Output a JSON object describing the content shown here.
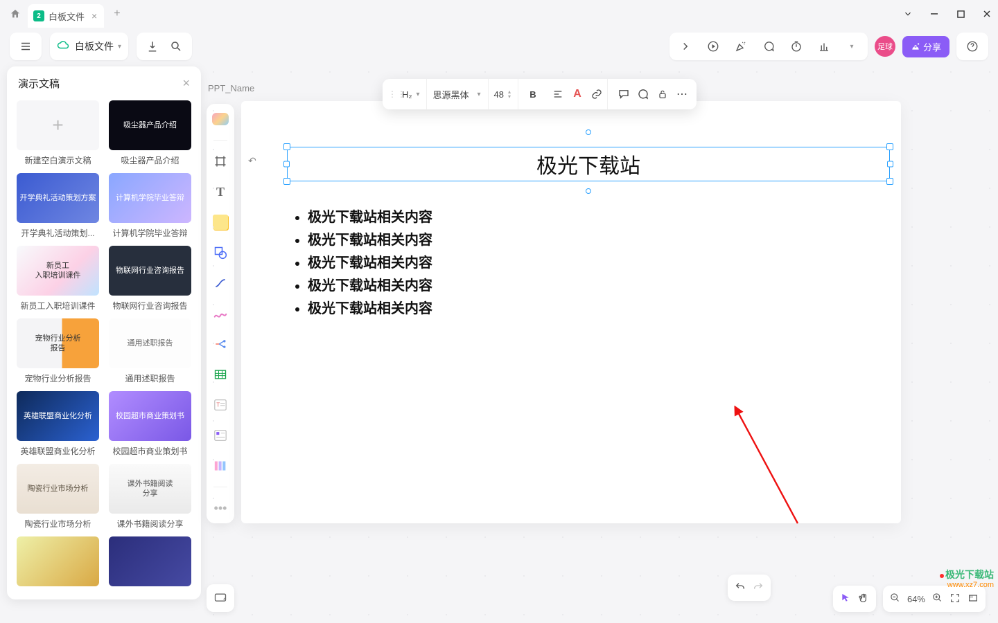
{
  "tabs": {
    "title": "白板文件"
  },
  "filedrop": {
    "name": "白板文件"
  },
  "toolbar_right": {
    "share": "分享",
    "avatar": "足球"
  },
  "panel": {
    "title": "演示文稿",
    "items": [
      {
        "label": "新建空白演示文稿",
        "bg": "add",
        "txt": "+"
      },
      {
        "label": "吸尘器产品介绍",
        "bg": "#0a0a14",
        "txt": "吸尘器产品介绍"
      },
      {
        "label": "开学典礼活动策划...",
        "bg": "linear-gradient(135deg,#3b5bd1,#6f86e2)",
        "txt": "开学典礼活动策划方案"
      },
      {
        "label": "计算机学院毕业答辩",
        "bg": "linear-gradient(135deg,#8aa7ff,#cdb6ff)",
        "txt": "计算机学院毕业答辩"
      },
      {
        "label": "新员工入职培训课件",
        "bg": "linear-gradient(135deg,#f8fafc,#fcd1e6 60%,#bfe3ff)",
        "txt": "新员工\\n入职培训课件",
        "fg": "#333"
      },
      {
        "label": "物联网行业咨询报告",
        "bg": "#272f3d",
        "txt": "物联网行业咨询报告"
      },
      {
        "label": "宠物行业分析报告",
        "bg": "linear-gradient(90deg,#f4f4f6 55%,#f7a23b 55%)",
        "txt": "宠物行业分析\\n报告",
        "fg": "#333"
      },
      {
        "label": "通用述职报告",
        "bg": "#fdfdfd",
        "txt": "通用述职报告",
        "fg": "#666"
      },
      {
        "label": "英雄联盟商业化分析",
        "bg": "linear-gradient(135deg,#0e2a5a,#2b61d1)",
        "txt": "英雄联盟商业化分析"
      },
      {
        "label": "校园超市商业策划书",
        "bg": "linear-gradient(135deg,#b18dff,#7a58e6)",
        "txt": "校园超市商业策划书"
      },
      {
        "label": "陶瓷行业市场分析",
        "bg": "linear-gradient(180deg,#f3ece4,#e9dfd2)",
        "txt": "陶瓷行业市场分析",
        "fg": "#5a5040"
      },
      {
        "label": "课外书籍阅读分享",
        "bg": "linear-gradient(180deg,#fafafa,#eaeaea)",
        "txt": "课外书籍阅读\\n分享",
        "fg": "#555"
      },
      {
        "label": "",
        "bg": "linear-gradient(135deg,#eef0a8,#d9a844)",
        "txt": ""
      },
      {
        "label": "",
        "bg": "linear-gradient(135deg,#2b2e7b,#464aa3)",
        "txt": ""
      }
    ]
  },
  "slide": {
    "name": "PPT_Name",
    "title": "极光下载站",
    "bullets": [
      "极光下载站相关内容",
      "极光下载站相关内容",
      "极光下载站相关内容",
      "极光下载站相关内容",
      "极光下载站相关内容"
    ]
  },
  "fmt": {
    "heading": "H₂",
    "font": "思源黑体",
    "size": "48"
  },
  "zoom": {
    "value": "64%"
  },
  "wm": {
    "l1": "极光下载站",
    "l2": "www.xz7.com"
  }
}
